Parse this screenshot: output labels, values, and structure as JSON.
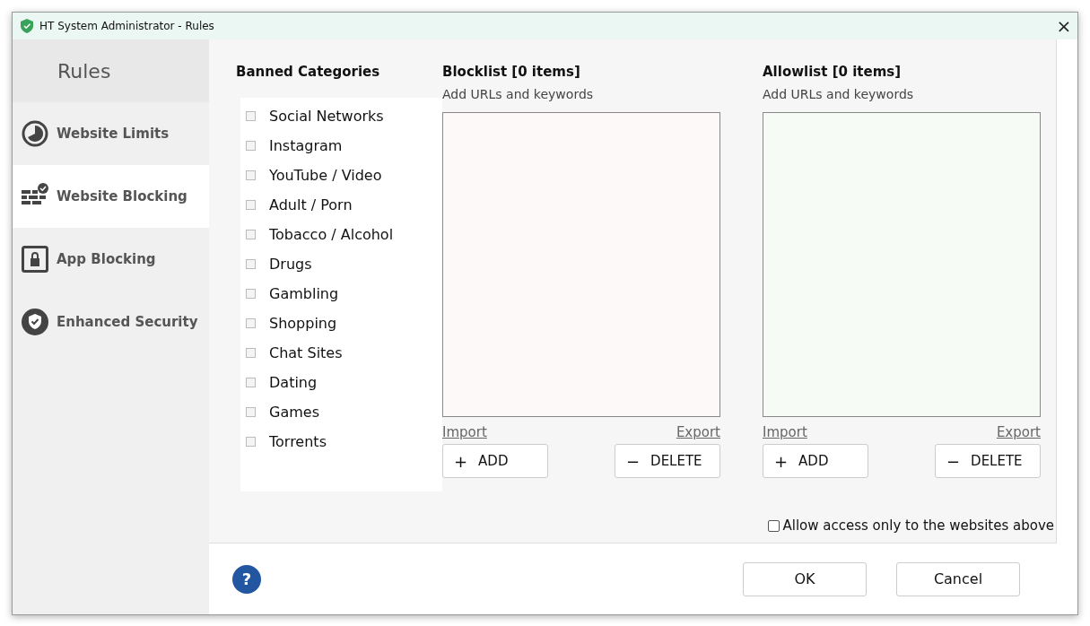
{
  "window": {
    "title": "HT System Administrator - Rules"
  },
  "sidebar": {
    "title": "Rules",
    "items": [
      {
        "label": "Website Limits",
        "selected": false
      },
      {
        "label": "Website Blocking",
        "selected": true
      },
      {
        "label": "App Blocking",
        "selected": false
      },
      {
        "label": "Enhanced Security",
        "selected": false
      }
    ]
  },
  "categories": {
    "title": "Banned Categories",
    "items": [
      {
        "label": "Social Networks",
        "checked": false
      },
      {
        "label": "Instagram",
        "checked": false
      },
      {
        "label": "YouTube / Video",
        "checked": false
      },
      {
        "label": "Adult / Porn",
        "checked": false
      },
      {
        "label": "Tobacco / Alcohol",
        "checked": false
      },
      {
        "label": "Drugs",
        "checked": false
      },
      {
        "label": "Gambling",
        "checked": false
      },
      {
        "label": "Shopping",
        "checked": false
      },
      {
        "label": "Chat Sites",
        "checked": false
      },
      {
        "label": "Dating",
        "checked": false
      },
      {
        "label": "Games",
        "checked": false
      },
      {
        "label": "Torrents",
        "checked": false
      }
    ]
  },
  "lists": [
    {
      "kind": "block",
      "title": "Blocklist [0 items]",
      "subtitle": "Add URLs and keywords",
      "import": "Import",
      "export": "Export",
      "add": {
        "icon": "+",
        "label": "ADD"
      },
      "delete": {
        "icon": "−",
        "label": "DELETE"
      }
    },
    {
      "kind": "allow",
      "title": "Allowlist [0 items]",
      "subtitle": "Add URLs and keywords",
      "import": "Import",
      "export": "Export",
      "add": {
        "icon": "+",
        "label": "ADD"
      },
      "delete": {
        "icon": "−",
        "label": "DELETE"
      }
    }
  ],
  "allow_only": {
    "label": "Allow access only to the websites above",
    "checked": false
  },
  "buttons": {
    "ok": "OK",
    "cancel": "Cancel"
  },
  "help": "?",
  "close": "×"
}
